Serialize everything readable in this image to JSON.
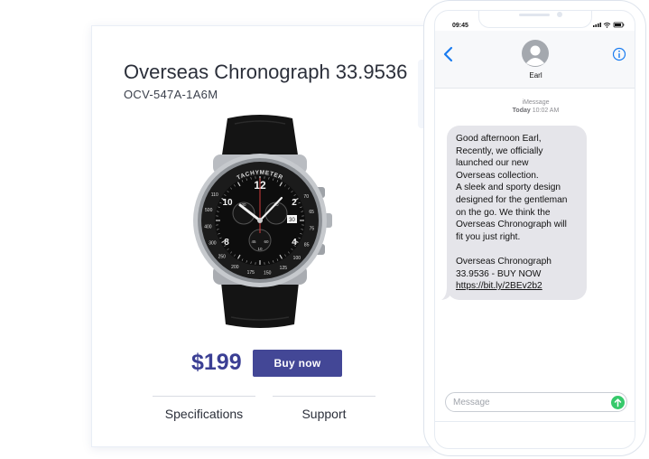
{
  "product": {
    "title": "Overseas Chronograph 33.9536",
    "sku": "OCV-547A-1A6M",
    "price": "$199",
    "buy_label": "Buy now",
    "tabs": [
      "Specifications",
      "Support"
    ],
    "watch_dial": {
      "bezel_text": "TACHYMETER",
      "hour_numerals": [
        "12",
        "2",
        "4",
        "8",
        "10"
      ],
      "tachy_marks": [
        "70",
        "65",
        "75",
        "85",
        "100",
        "125",
        "150",
        "175",
        "200",
        "250",
        "300",
        "400",
        "500",
        "110"
      ],
      "subdial_numbers": [
        "30",
        "20",
        "45",
        "60",
        "10"
      ],
      "date": "30"
    },
    "colors": {
      "accent": "#434796",
      "price": "#3b3f94"
    }
  },
  "phone": {
    "time": "09:45",
    "contact_name": "Earl",
    "service": "iMessage",
    "timestamp_day": "Today",
    "timestamp_time": "10:02 AM",
    "message_lines": [
      "Good afternoon Earl,",
      "Recently, we officially",
      "launched our new",
      "Overseas collection.",
      "A sleek and sporty design",
      "designed for the gentleman",
      "on the go. We think the",
      "Overseas Chronograph will",
      "fit you just right.",
      "",
      "Overseas Chronograph",
      "33.9536 - BUY NOW",
      "https://bit.ly/2BEv2b2"
    ],
    "input_placeholder": "Message",
    "icons": [
      "back-chevron-icon",
      "contact-avatar-icon",
      "info-icon",
      "send-arrow-icon",
      "signal-icon",
      "wifi-icon",
      "battery-icon"
    ],
    "colors": {
      "ios_blue": "#1a7cf0",
      "send_green": "#37c96b",
      "bubble": "#e5e5ea"
    }
  }
}
